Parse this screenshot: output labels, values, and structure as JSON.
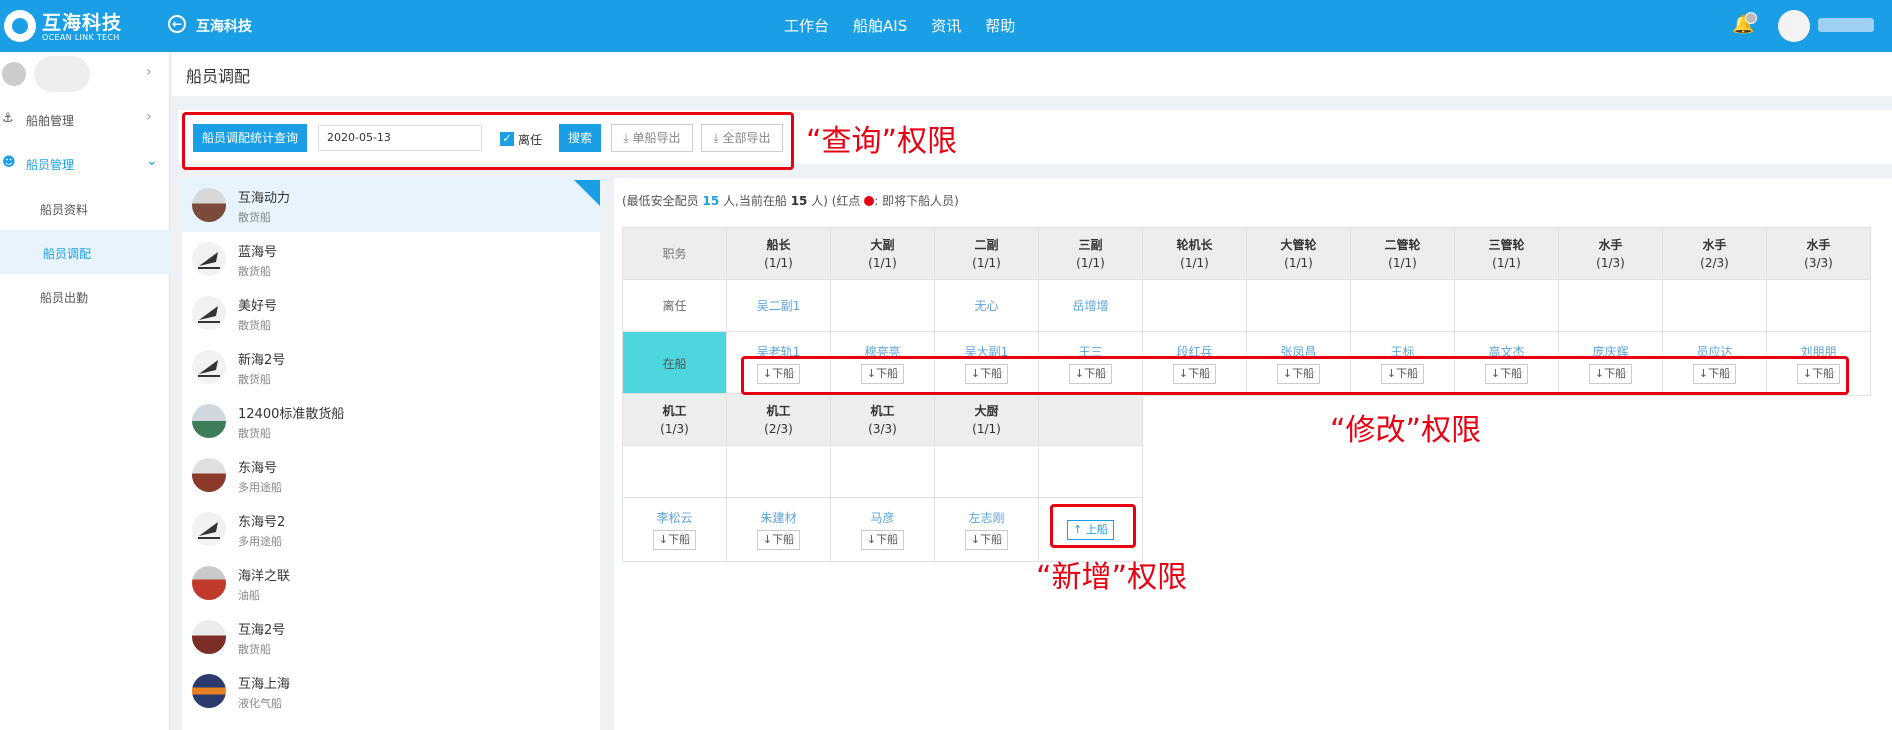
{
  "header": {
    "logo_name": "互海科技",
    "logo_sub": "OCEAN LINK TECH",
    "company": "互海科技",
    "nav": [
      "工作台",
      "船舶AIS",
      "资讯",
      "帮助"
    ]
  },
  "sidebar": {
    "items": [
      {
        "label": "船舶管理"
      },
      {
        "label": "船员管理"
      }
    ],
    "subitems": [
      {
        "label": "船员资料"
      },
      {
        "label": "船员调配"
      },
      {
        "label": "船员出勤"
      }
    ]
  },
  "page_title": "船员调配",
  "search": {
    "stats_button": "船员调配统计查询",
    "date_value": "2020-05-13",
    "checkbox_label": "离任",
    "search_button": "搜索",
    "export_single": "单船导出",
    "export_all": "全部导出"
  },
  "annotations": {
    "query": "“查询”权限",
    "modify": "“修改”权限",
    "add": "“新增”权限"
  },
  "ships": [
    {
      "name": "互海动力",
      "type": "散货船"
    },
    {
      "name": "蓝海号",
      "type": "散货船"
    },
    {
      "name": "美好号",
      "type": "散货船"
    },
    {
      "name": "新海2号",
      "type": "散货船"
    },
    {
      "name": "12400标准散货船",
      "type": "散货船"
    },
    {
      "name": "东海号",
      "type": "多用途船"
    },
    {
      "name": "东海号2",
      "type": "多用途船"
    },
    {
      "name": "海洋之联",
      "type": "油船"
    },
    {
      "name": "互海2号",
      "type": "散货船"
    },
    {
      "name": "互海上海",
      "type": "液化气船"
    }
  ],
  "summary": {
    "prefix": "(最低安全配员",
    "min_crew": "15",
    "mid": "人,当前在船",
    "current": "15",
    "suffix_a": "人) (红点",
    "suffix_b": ":  即将下船人员)"
  },
  "table": {
    "row_labels": {
      "duty": "职务",
      "leaving": "离任",
      "onboard": "在船"
    },
    "off_label": "下船",
    "on_label": "上船",
    "row1": [
      {
        "title": "船长",
        "count": "(1/1)",
        "leaving": "吴二副1",
        "onboard": "吴老轨1"
      },
      {
        "title": "大副",
        "count": "(1/1)",
        "leaving": "",
        "onboard": "穆亮亮"
      },
      {
        "title": "二副",
        "count": "(1/1)",
        "leaving": "无心",
        "onboard": "吴大副1"
      },
      {
        "title": "三副",
        "count": "(1/1)",
        "leaving": "岳增增",
        "onboard": "王三"
      },
      {
        "title": "轮机长",
        "count": "(1/1)",
        "leaving": "",
        "onboard": "段红兵"
      },
      {
        "title": "大管轮",
        "count": "(1/1)",
        "leaving": "",
        "onboard": "张凤昌"
      },
      {
        "title": "二管轮",
        "count": "(1/1)",
        "leaving": "",
        "onboard": "王标"
      },
      {
        "title": "三管轮",
        "count": "(1/1)",
        "leaving": "",
        "onboard": "高文杰"
      },
      {
        "title": "水手",
        "count": "(1/3)",
        "leaving": "",
        "onboard": "庞庆辉"
      },
      {
        "title": "水手",
        "count": "(2/3)",
        "leaving": "",
        "onboard": "员应达"
      },
      {
        "title": "水手",
        "count": "(3/3)",
        "leaving": "",
        "onboard": "刘朋朋"
      }
    ],
    "row2": [
      {
        "title": "机工",
        "count": "(1/3)",
        "leaving": "",
        "onboard": "李松云"
      },
      {
        "title": "机工",
        "count": "(2/3)",
        "leaving": "",
        "onboard": "朱建材"
      },
      {
        "title": "机工",
        "count": "(3/3)",
        "leaving": "",
        "onboard": "马彦"
      },
      {
        "title": "大厨",
        "count": "(1/1)",
        "leaving": "",
        "onboard": "左志刚"
      }
    ]
  },
  "colors": {
    "primary": "#1a9fe6",
    "annotation": "#e60012",
    "onboard_cell": "#4ed6df"
  }
}
